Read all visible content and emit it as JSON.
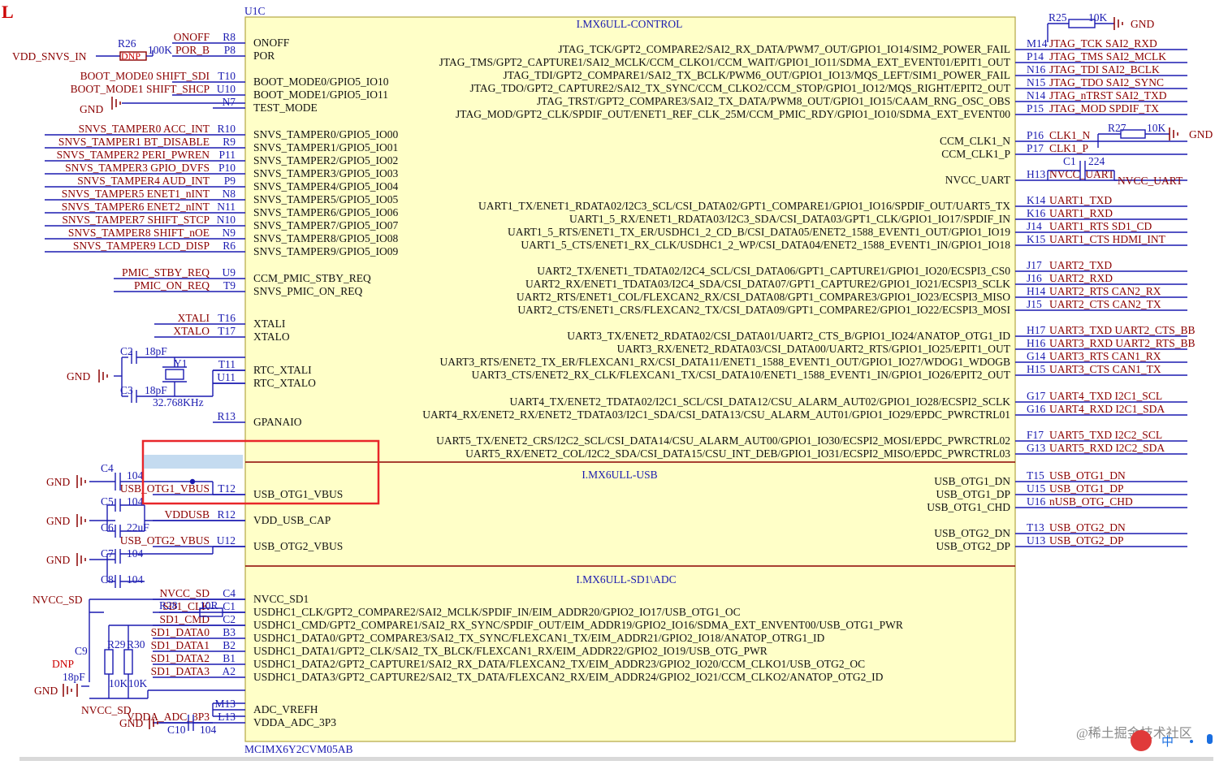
{
  "corner_mark": "L",
  "part": {
    "designator": "U1C",
    "footer": "MCIMX6Y2CVM05AB",
    "body_color": "#ffffc8",
    "border_color": "#b5a642"
  },
  "colors": {
    "net": "#8b0000",
    "section": "#1a1ab0",
    "wire": "#1a1ab0",
    "pin_text": "#111111",
    "highlight": "#e8262a",
    "gnd": "#8b0000"
  },
  "sections": [
    {
      "id": "control",
      "title": "I.MX6ULL-CONTROL"
    },
    {
      "id": "usb",
      "title": "I.MX6ULL-USB"
    },
    {
      "id": "sd1",
      "title": "I.MX6ULL-SD1\\ADC"
    }
  ],
  "left_pins": [
    {
      "pin": "R8",
      "name": "ONOFF",
      "net": "ONOFF"
    },
    {
      "pin": "P8",
      "name": "POR",
      "net": "POR_B"
    },
    {
      "pin": "T10",
      "name": "BOOT_MODE0/GPIO5_IO10",
      "net": "BOOT_MODE0  SHIFT_SDI"
    },
    {
      "pin": "U10",
      "name": "BOOT_MODE1/GPIO5_IO11",
      "net": "BOOT_MODE1  SHIFT_SHCP"
    },
    {
      "pin": "N7",
      "name": "TEST_MODE",
      "net": ""
    },
    {
      "pin": "R10",
      "name": "SNVS_TAMPER0/GPIO5_IO00",
      "net": "SNVS_TAMPER0  ACC_INT"
    },
    {
      "pin": "R9",
      "name": "SNVS_TAMPER1/GPIO5_IO01",
      "net": "SNVS_TAMPER1  BT_DISABLE"
    },
    {
      "pin": "P11",
      "name": "SNVS_TAMPER2/GPIO5_IO02",
      "net": "SNVS_TAMPER2  PERI_PWREN"
    },
    {
      "pin": "P10",
      "name": "SNVS_TAMPER3/GPIO5_IO03",
      "net": "SNVS_TAMPER3  GPIO_DVFS"
    },
    {
      "pin": "P9",
      "name": "SNVS_TAMPER4/GPIO5_IO04",
      "net": "SNVS_TAMPER4  AUD_INT"
    },
    {
      "pin": "N8",
      "name": "SNVS_TAMPER5/GPIO5_IO05",
      "net": "SNVS_TAMPER5  ENET1_nINT"
    },
    {
      "pin": "N11",
      "name": "SNVS_TAMPER6/GPIO5_IO06",
      "net": "SNVS_TAMPER6  ENET2_nINT"
    },
    {
      "pin": "N10",
      "name": "SNVS_TAMPER7/GPIO5_IO07",
      "net": "SNVS_TAMPER7  SHIFT_STCP"
    },
    {
      "pin": "N9",
      "name": "SNVS_TAMPER8/GPIO5_IO08",
      "net": "SNVS_TAMPER8  SHIFT_nOE"
    },
    {
      "pin": "R6",
      "name": "SNVS_TAMPER9/GPIO5_IO09",
      "net": "SNVS_TAMPER9  LCD_DISP"
    },
    {
      "pin": "U9",
      "name": "CCM_PMIC_STBY_REQ",
      "net": "PMIC_STBY_REQ"
    },
    {
      "pin": "T9",
      "name": "SNVS_PMIC_ON_REQ",
      "net": "PMIC_ON_REQ"
    },
    {
      "pin": "T16",
      "name": "XTALI",
      "net": "XTALI"
    },
    {
      "pin": "T17",
      "name": "XTALO",
      "net": "XTALO"
    },
    {
      "pin": "T11",
      "name": "RTC_XTALI",
      "net": ""
    },
    {
      "pin": "U11",
      "name": "RTC_XTALO",
      "net": ""
    },
    {
      "pin": "R13",
      "name": "GPANAIO",
      "net": ""
    },
    {
      "pin": "T12",
      "name": "USB_OTG1_VBUS",
      "net": "USB_OTG1_VBUS"
    },
    {
      "pin": "R12",
      "name": "VDD_USB_CAP",
      "net": "VDDUSB"
    },
    {
      "pin": "U12",
      "name": "USB_OTG2_VBUS",
      "net": "USB_OTG2_VBUS"
    },
    {
      "pin": "C4",
      "name": "NVCC_SD1",
      "net": "NVCC_SD"
    },
    {
      "pin": "C1",
      "name": "USDHC1_CLK/GPT2_COMPARE2/SAI2_MCLK/SPDIF_IN/EIM_ADDR20/GPIO2_IO17/USB_OTG1_OC",
      "net": "SD1_CLK"
    },
    {
      "pin": "C2",
      "name": "USDHC1_CMD/GPT2_COMPARE1/SAI2_RX_SYNC/SPDIF_OUT/EIM_ADDR19/GPIO2_IO16/SDMA_EXT_ENVENT00/USB_OTG1_PWR",
      "net": "SD1_CMD"
    },
    {
      "pin": "B3",
      "name": "USDHC1_DATA0/GPT2_COMPARE3/SAI2_TX_SYNC/FLEXCAN1_TX/EIM_ADDR21/GPIO2_IO18/ANATOP_OTRG1_ID",
      "net": "SD1_DATA0"
    },
    {
      "pin": "B2",
      "name": "USDHC1_DATA1/GPT2_CLK/SAI2_TX_BLCK/FLEXCAN1_RX/EIM_ADDR22/GPIO2_IO19/USB_OTG_PWR",
      "net": "SD1_DATA1"
    },
    {
      "pin": "B1",
      "name": "USDHC1_DATA2/GPT2_CAPTURE1/SAI2_RX_DATA/FLEXCAN2_TX/EIM_ADDR23/GPIO2_IO20/CCM_CLKO1/USB_OTG2_OC",
      "net": "SD1_DATA2"
    },
    {
      "pin": "A2",
      "name": "USDHC1_DATA3/GPT2_CAPTURE2/SAI2_TX_DATA/FLEXCAN2_RX/EIM_ADDR24/GPIO2_IO21/CCM_CLKO2/ANATOP_OTG2_ID",
      "net": "SD1_DATA3"
    },
    {
      "pin": "M13",
      "name": "ADC_VREFH",
      "net": ""
    },
    {
      "pin": "L13",
      "name": "VDDA_ADC_3P3",
      "net": "VDDA_ADC_3P3"
    }
  ],
  "right_pins": [
    {
      "pin": "M14",
      "name": "JTAG_TCK/GPT2_COMPARE2/SAI2_RX_DATA/PWM7_OUT/GPIO1_IO14/SIM2_POWER_FAIL",
      "net": "JTAG_TCK   SAI2_RXD"
    },
    {
      "pin": "P14",
      "name": "JTAG_TMS/GPT2_CAPTURE1/SAI2_MCLK/CCM_CLKO1/CCM_WAIT/GPIO1_IO11/SDMA_EXT_EVENT01/EPIT1_OUT",
      "net": "JTAG_TMS   SAI2_MCLK"
    },
    {
      "pin": "N16",
      "name": "JTAG_TDI/GPT2_COMPARE1/SAI2_TX_BCLK/PWM6_OUT/GPIO1_IO13/MQS_LEFT/SIM1_POWER_FAIL",
      "net": "JTAG_TDI   SAI2_BCLK"
    },
    {
      "pin": "N15",
      "name": "JTAG_TDO/GPT2_CAPTURE2/SAI2_TX_SYNC/CCM_CLKO2/CCM_STOP/GPIO1_IO12/MQS_RIGHT/EPIT2_OUT",
      "net": "JTAG_TDO   SAI2_SYNC"
    },
    {
      "pin": "N14",
      "name": "JTAG_TRST/GPT2_COMPARE3/SAI2_TX_DATA/PWM8_OUT/GPIO1_IO15/CAAM_RNG_OSC_OBS",
      "net": "JTAG_nTRST SAI2_TXD"
    },
    {
      "pin": "P15",
      "name": "JTAG_MOD/GPT2_CLK/SPDIF_OUT/ENET1_REF_CLK_25M/CCM_PMIC_RDY/GPIO1_IO10/SDMA_EXT_EVENT00",
      "net": "JTAG_MOD   SPDIF_TX"
    },
    {
      "pin": "P16",
      "name": "CCM_CLK1_N",
      "net": "CLK1_N"
    },
    {
      "pin": "P17",
      "name": "CCM_CLK1_P",
      "net": "CLK1_P"
    },
    {
      "pin": "H13",
      "name": "NVCC_UART",
      "net": "NVCC_UART"
    },
    {
      "pin": "K14",
      "name": "UART1_TX/ENET1_RDATA02/I2C3_SCL/CSI_DATA02/GPT1_COMPARE1/GPIO1_IO16/SPDIF_OUT/UART5_TX",
      "net": "UART1_TXD"
    },
    {
      "pin": "K16",
      "name": "UART1_5_RX/ENET1_RDATA03/I2C3_SDA/CSI_DATA03/GPT1_CLK/GPIO1_IO17/SPDIF_IN",
      "net": "UART1_RXD"
    },
    {
      "pin": "J14",
      "name": "UART1_5_RTS/ENET1_TX_ER/USDHC1_2_CD_B/CSI_DATA05/ENET2_1588_EVENT1_OUT/GPIO1_IO19",
      "net": "UART1_RTS   SD1_CD"
    },
    {
      "pin": "K15",
      "name": "UART1_5_CTS/ENET1_RX_CLK/USDHC1_2_WP/CSI_DATA04/ENET2_1588_EVENT1_IN/GPIO1_IO18",
      "net": "UART1_CTS   HDMI_INT"
    },
    {
      "pin": "J17",
      "name": "UART2_TX/ENET1_TDATA02/I2C4_SCL/CSI_DATA06/GPT1_CAPTURE1/GPIO1_IO20/ECSPI3_CS0",
      "net": "UART2_TXD"
    },
    {
      "pin": "J16",
      "name": "UART2_RX/ENET1_TDATA03/I2C4_SDA/CSI_DATA07/GPT1_CAPTURE2/GPIO1_IO21/ECSPI3_SCLK",
      "net": "UART2_RXD"
    },
    {
      "pin": "H14",
      "name": "UART2_RTS/ENET1_COL/FLEXCAN2_RX/CSI_DATA08/GPT1_COMPARE3/GPIO1_IO23/ECSPI3_MISO",
      "net": "UART2_RTS   CAN2_RX"
    },
    {
      "pin": "J15",
      "name": "UART2_CTS/ENET1_CRS/FLEXCAN2_TX/CSI_DATA09/GPT1_COMPARE2/GPIO1_IO22/ECSPI3_MOSI",
      "net": "UART2_CTS   CAN2_TX"
    },
    {
      "pin": "H17",
      "name": "UART3_TX/ENET2_RDATA02/CSI_DATA01/UART2_CTS_B/GPIO1_IO24/ANATOP_OTG1_ID",
      "net": "UART3_TXD   UART2_CTS_BB"
    },
    {
      "pin": "H16",
      "name": "UART3_RX/ENET2_RDATA03/CSI_DATA00/UART2_RTS/GPIO1_IO25/EPIT1_OUT",
      "net": "UART3_RXD   UART2_RTS_BB"
    },
    {
      "pin": "G14",
      "name": "UART3_RTS/ENET2_TX_ER/FLEXCAN1_RX/CSI_DATA11/ENET1_1588_EVENT1_OUT/GPIO1_IO27/WDOG1_WDOGB",
      "net": "UART3_RTS   CAN1_RX"
    },
    {
      "pin": "H15",
      "name": "UART3_CTS/ENET2_RX_CLK/FLEXCAN1_TX/CSI_DATA10/ENET1_1588_EVENT1_IN/GPIO1_IO26/EPIT2_OUT",
      "net": "UART3_CTS   CAN1_TX"
    },
    {
      "pin": "G17",
      "name": "UART4_TX/ENET2_TDATA02/I2C1_SCL/CSI_DATA12/CSU_ALARM_AUT02/GPIO1_IO28/ECSPI2_SCLK",
      "net": "UART4_TXD   I2C1_SCL"
    },
    {
      "pin": "G16",
      "name": "UART4_RX/ENET2_RX/ENET2_TDATA03/I2C1_SDA/CSI_DATA13/CSU_ALARM_AUT01/GPIO1_IO29/EPDC_PWRCTRL01",
      "net": "UART4_RXD   I2C1_SDA"
    },
    {
      "pin": "F17",
      "name": "UART5_TX/ENET2_CRS/I2C2_SCL/CSI_DATA14/CSU_ALARM_AUT00/GPIO1_IO30/ECSPI2_MOSI/EPDC_PWRCTRL02",
      "net": "UART5_TXD   I2C2_SCL"
    },
    {
      "pin": "G13",
      "name": "UART5_RX/ENET2_COL/I2C2_SDA/CSI_DATA15/CSU_INT_DEB/GPIO1_IO31/ECSPI2_MISO/EPDC_PWRCTRL03",
      "net": "UART5_RXD   I2C2_SDA"
    },
    {
      "pin": "T15",
      "name": "USB_OTG1_DN",
      "net": "USB_OTG1_DN"
    },
    {
      "pin": "U15",
      "name": "USB_OTG1_DP",
      "net": "USB_OTG1_DP"
    },
    {
      "pin": "U16",
      "name": "USB_OTG1_CHD",
      "net": "nUSB_OTG_CHD"
    },
    {
      "pin": "T13",
      "name": "USB_OTG2_DN",
      "net": "USB_OTG2_DN"
    },
    {
      "pin": "U13",
      "name": "USB_OTG2_DP",
      "net": "USB_OTG2_DP"
    }
  ],
  "components": [
    {
      "ref": "R26",
      "value": "100K",
      "extra": "DNP"
    },
    {
      "ref": "R25",
      "value": "10K"
    },
    {
      "ref": "R27",
      "value": "10K"
    },
    {
      "ref": "C1",
      "value": "224"
    },
    {
      "ref": "C2",
      "value": "18pF"
    },
    {
      "ref": "C3",
      "value": "18pF"
    },
    {
      "ref": "Y1",
      "value": "32.768KHz"
    },
    {
      "ref": "C4",
      "value": "104"
    },
    {
      "ref": "C5",
      "value": "104"
    },
    {
      "ref": "C6",
      "value": "22uF"
    },
    {
      "ref": "C7",
      "value": "104"
    },
    {
      "ref": "C8",
      "value": "104"
    },
    {
      "ref": "R28",
      "value": "10R"
    },
    {
      "ref": "R29",
      "value": "10K"
    },
    {
      "ref": "R30",
      "value": "10K"
    },
    {
      "ref": "C9",
      "value": "18pF",
      "extra": "DNP"
    },
    {
      "ref": "C10",
      "value": "104"
    }
  ],
  "power": {
    "vdd_snvs": "VDD_SNVS_IN",
    "gnd": "GND",
    "nvcc_sd": "NVCC_SD",
    "nvcc_sd2": "NVCC_SD",
    "nvcc_uart": "NVCC_UART"
  },
  "watermark": "@稀土掘金技术社区",
  "ime_icon": "中"
}
